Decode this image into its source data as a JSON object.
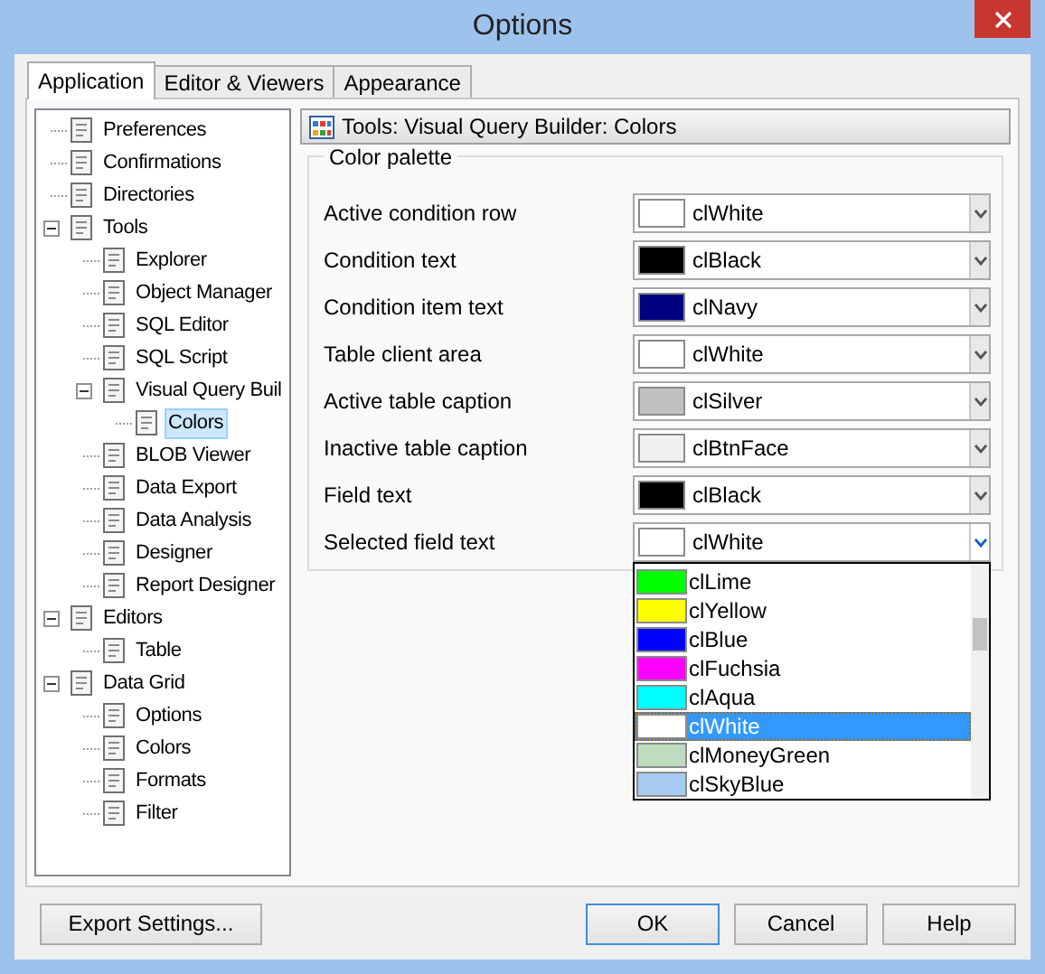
{
  "window": {
    "title": "Options"
  },
  "tabs": [
    {
      "label": "Application",
      "selected": true
    },
    {
      "label": "Editor & Viewers",
      "selected": false
    },
    {
      "label": "Appearance",
      "selected": false
    }
  ],
  "tree": [
    {
      "label": "Preferences",
      "selected": false
    },
    {
      "label": "Confirmations",
      "selected": false
    },
    {
      "label": "Directories",
      "selected": false
    },
    {
      "label": "Tools",
      "selected": false,
      "expanded": true,
      "children": [
        {
          "label": "Explorer",
          "selected": false
        },
        {
          "label": "Object Manager",
          "selected": false
        },
        {
          "label": "SQL Editor",
          "selected": false
        },
        {
          "label": "SQL Script",
          "selected": false
        },
        {
          "label": "Visual Query Buil",
          "selected": false,
          "expanded": true,
          "children": [
            {
              "label": "Colors",
              "selected": true
            }
          ]
        },
        {
          "label": "BLOB Viewer",
          "selected": false
        },
        {
          "label": "Data Export",
          "selected": false
        },
        {
          "label": "Data Analysis",
          "selected": false
        },
        {
          "label": "Designer",
          "selected": false
        },
        {
          "label": "Report Designer",
          "selected": false
        }
      ]
    },
    {
      "label": "Editors",
      "selected": false,
      "expanded": true,
      "children": [
        {
          "label": "Table",
          "selected": false
        }
      ]
    },
    {
      "label": "Data Grid",
      "selected": false,
      "expanded": true,
      "children": [
        {
          "label": "Options",
          "selected": false
        },
        {
          "label": "Colors",
          "selected": false
        },
        {
          "label": "Formats",
          "selected": false
        },
        {
          "label": "Filter",
          "selected": false
        }
      ]
    }
  ],
  "page_header": {
    "title": "Tools: Visual Query Builder: Colors"
  },
  "palette": {
    "legend": "Color palette",
    "rows": [
      {
        "label": "Active condition row",
        "value": "clWhite",
        "color": "#ffffff",
        "open": false
      },
      {
        "label": "Condition text",
        "value": "clBlack",
        "color": "#000000",
        "open": false
      },
      {
        "label": "Condition item text",
        "value": "clNavy",
        "color": "#000080",
        "open": false
      },
      {
        "label": "Table client area",
        "value": "clWhite",
        "color": "#ffffff",
        "open": false
      },
      {
        "label": "Active table caption",
        "value": "clSilver",
        "color": "#c0c0c0",
        "open": false
      },
      {
        "label": "Inactive table caption",
        "value": "clBtnFace",
        "color": "#f0f0f0",
        "open": false
      },
      {
        "label": "Field text",
        "value": "clBlack",
        "color": "#000000",
        "open": false
      },
      {
        "label": "Selected field text",
        "value": "clWhite",
        "color": "#ffffff",
        "open": true
      }
    ],
    "dropdown": [
      {
        "label": "clLime",
        "color": "#00ff00",
        "selected": false
      },
      {
        "label": "clYellow",
        "color": "#ffff00",
        "selected": false
      },
      {
        "label": "clBlue",
        "color": "#0000ff",
        "selected": false
      },
      {
        "label": "clFuchsia",
        "color": "#ff00ff",
        "selected": false
      },
      {
        "label": "clAqua",
        "color": "#00ffff",
        "selected": false
      },
      {
        "label": "clWhite",
        "color": "#ffffff",
        "selected": true
      },
      {
        "label": "clMoneyGreen",
        "color": "#c0dcc0",
        "selected": false
      },
      {
        "label": "clSkyBlue",
        "color": "#a6caf0",
        "selected": false
      }
    ]
  },
  "buttons": {
    "left": [
      {
        "label": "Export Settings...",
        "default": false
      }
    ],
    "right": [
      {
        "label": "OK",
        "default": true
      },
      {
        "label": "Cancel",
        "default": false
      },
      {
        "label": "Help",
        "default": false
      }
    ]
  }
}
